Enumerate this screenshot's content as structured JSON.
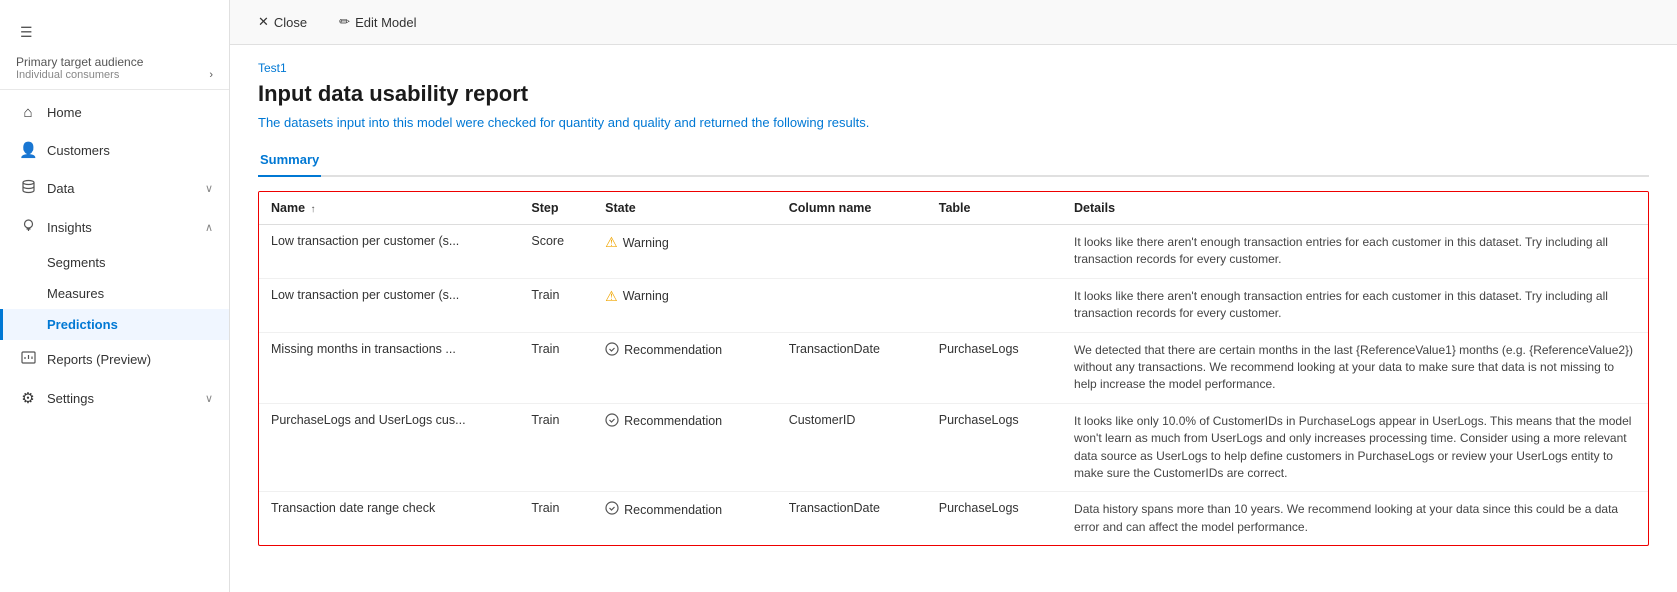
{
  "sidebar": {
    "hamburger": "☰",
    "primary_label": "Primary target audience",
    "primary_sub": "Individual consumers",
    "nav_items": [
      {
        "id": "home",
        "label": "Home",
        "icon": "⌂",
        "active": false,
        "expandable": false
      },
      {
        "id": "customers",
        "label": "Customers",
        "icon": "👤",
        "active": false,
        "expandable": false
      },
      {
        "id": "data",
        "label": "Data",
        "icon": "🗄",
        "active": false,
        "expandable": true
      },
      {
        "id": "insights",
        "label": "Insights",
        "icon": "💡",
        "active": false,
        "expandable": true,
        "expanded": true
      },
      {
        "id": "segments",
        "label": "Segments",
        "icon": "",
        "active": false,
        "sub": true
      },
      {
        "id": "measures",
        "label": "Measures",
        "icon": "",
        "active": false,
        "sub": true
      },
      {
        "id": "predictions",
        "label": "Predictions",
        "icon": "",
        "active": true,
        "sub": true
      },
      {
        "id": "reports",
        "label": "Reports (Preview)",
        "icon": "📊",
        "active": false,
        "expandable": false
      },
      {
        "id": "settings",
        "label": "Settings",
        "icon": "⚙",
        "active": false,
        "expandable": true
      }
    ]
  },
  "topbar": {
    "close_label": "Close",
    "edit_label": "Edit Model",
    "close_icon": "✕",
    "edit_icon": "✏"
  },
  "content": {
    "breadcrumb": "Test1",
    "title": "Input data usability report",
    "subtitle": "The datasets input into this model were checked for quantity and quality and returned the following results.",
    "tabs": [
      {
        "id": "summary",
        "label": "Summary",
        "active": true
      }
    ],
    "table": {
      "columns": [
        {
          "id": "name",
          "label": "Name",
          "sort": "↑"
        },
        {
          "id": "step",
          "label": "Step",
          "sort": ""
        },
        {
          "id": "state",
          "label": "State",
          "sort": ""
        },
        {
          "id": "column_name",
          "label": "Column name",
          "sort": ""
        },
        {
          "id": "table",
          "label": "Table",
          "sort": ""
        },
        {
          "id": "details",
          "label": "Details",
          "sort": ""
        }
      ],
      "rows": [
        {
          "name": "Low transaction per customer (s...",
          "step": "Score",
          "state": "Warning",
          "state_type": "warning",
          "column_name": "",
          "table": "",
          "details": "It looks like there aren't enough transaction entries for each customer in this dataset. Try including all transaction records for every customer."
        },
        {
          "name": "Low transaction per customer (s...",
          "step": "Train",
          "state": "Warning",
          "state_type": "warning",
          "column_name": "",
          "table": "",
          "details": "It looks like there aren't enough transaction entries for each customer in this dataset. Try including all transaction records for every customer."
        },
        {
          "name": "Missing months in transactions ...",
          "step": "Train",
          "state": "Recommendation",
          "state_type": "recommendation",
          "column_name": "TransactionDate",
          "table": "PurchaseLogs",
          "details": "We detected that there are certain months in the last {ReferenceValue1} months (e.g. {ReferenceValue2}) without any transactions. We recommend looking at your data to make sure that data is not missing to help increase the model performance."
        },
        {
          "name": "PurchaseLogs and UserLogs cus...",
          "step": "Train",
          "state": "Recommendation",
          "state_type": "recommendation",
          "column_name": "CustomerID",
          "table": "PurchaseLogs",
          "details": "It looks like only 10.0% of CustomerIDs in PurchaseLogs appear in UserLogs. This means that the model won't learn as much from UserLogs and only increases processing time. Consider using a more relevant data source as UserLogs to help define customers in PurchaseLogs or review your UserLogs entity to make sure the CustomerIDs are correct."
        },
        {
          "name": "Transaction date range check",
          "step": "Train",
          "state": "Recommendation",
          "state_type": "recommendation",
          "column_name": "TransactionDate",
          "table": "PurchaseLogs",
          "details": "Data history spans more than 10 years. We recommend looking at your data since this could be a data error and can affect the model performance."
        }
      ]
    }
  }
}
